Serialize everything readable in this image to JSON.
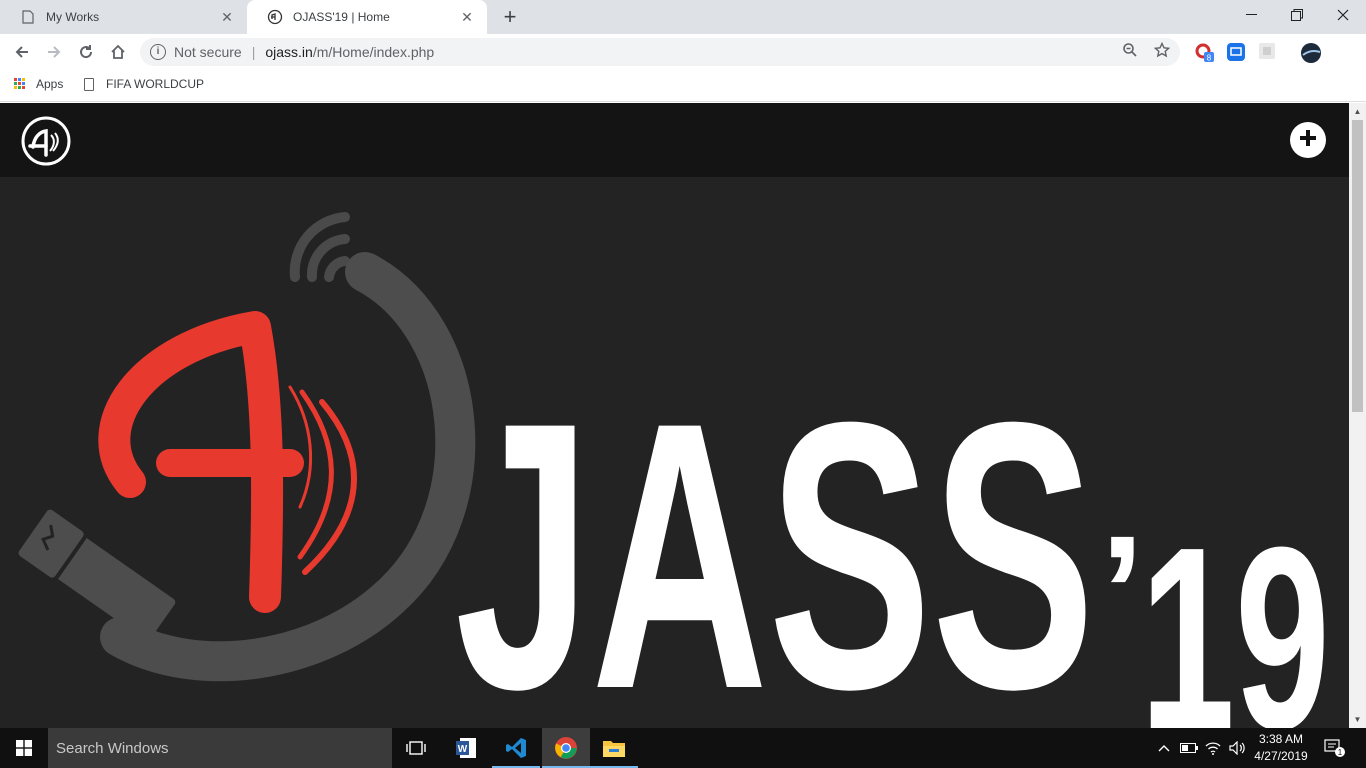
{
  "browser": {
    "tabs": [
      {
        "title": "My Works",
        "active": false
      },
      {
        "title": "OJASS'19 | Home",
        "active": true
      }
    ],
    "address": {
      "security_label": "Not secure",
      "host": "ojass.in",
      "path": "/m/Home/index.php"
    },
    "extension_badge": "8",
    "bookmarks": [
      {
        "label": "Apps",
        "icon": "apps-grid-icon"
      },
      {
        "label": "FIFA WORLDCUP",
        "icon": "page-icon"
      }
    ]
  },
  "site": {
    "header_logo": "ojass-monogram-logo",
    "menu_icon": "plus-icon",
    "hero": {
      "wordmark_main": "JASS",
      "wordmark_apostrophe": "’",
      "wordmark_year": "19",
      "colors": {
        "accent": "#e8392f",
        "ring": "#555555",
        "text": "#ffffff",
        "background": "#232323"
      }
    }
  },
  "taskbar": {
    "search_placeholder": "Search Windows",
    "apps": [
      "task-view-icon",
      "word-icon",
      "vscode-icon",
      "chrome-icon",
      "file-explorer-icon"
    ],
    "time": "3:38 AM",
    "date": "4/27/2019",
    "notification_count": "1"
  }
}
